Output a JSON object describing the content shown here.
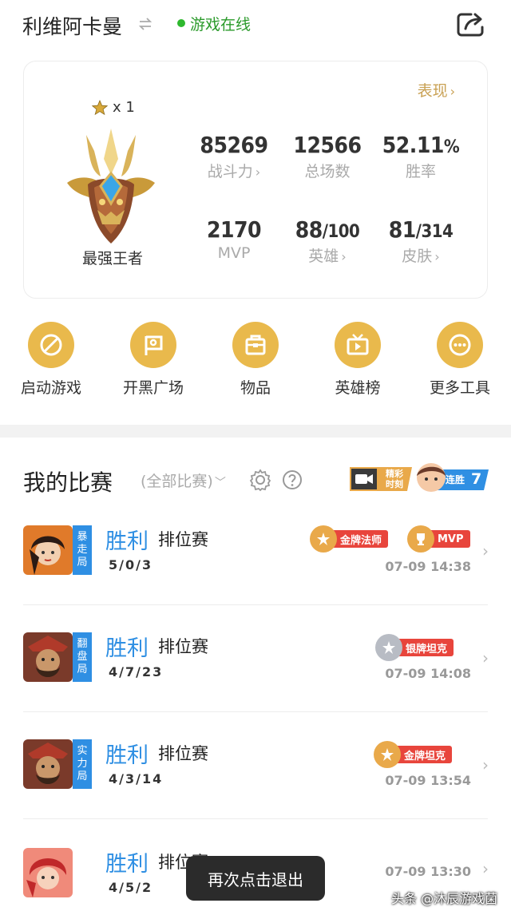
{
  "header": {
    "player_name": "利维阿卡曼",
    "status": "游戏在线"
  },
  "profile": {
    "performance_link": "表现",
    "stars": "x 1",
    "rank": "最强王者",
    "stats": [
      {
        "value": "85269",
        "label": "战斗力",
        "has_chevron": true
      },
      {
        "value": "12566",
        "label": "总场数",
        "has_chevron": false
      },
      {
        "value": "52.11",
        "suffix": "%",
        "label": "胜率",
        "has_chevron": false
      },
      {
        "value": "2170",
        "label": "MVP",
        "has_chevron": false
      },
      {
        "value": "88",
        "suffix": "/100",
        "label": "英雄",
        "has_chevron": true
      },
      {
        "value": "81",
        "suffix": "/314",
        "label": "皮肤",
        "has_chevron": true
      }
    ]
  },
  "tools": [
    {
      "label": "启动游戏",
      "icon": "launch-game-icon"
    },
    {
      "label": "开黑广场",
      "icon": "team-square-icon"
    },
    {
      "label": "物品",
      "icon": "items-bag-icon"
    },
    {
      "label": "英雄榜",
      "icon": "hero-ranking-icon"
    },
    {
      "label": "更多工具",
      "icon": "more-icon"
    }
  ],
  "matches_section": {
    "title": "我的比赛",
    "filter": "(全部比赛)",
    "highlight_badge": {
      "line1": "精彩",
      "line2": "时刻"
    },
    "streak_badge": {
      "label": "连胜",
      "count": "7"
    }
  },
  "matches": [
    {
      "mode_tag": [
        "暴",
        "走",
        "局"
      ],
      "result": "胜利",
      "mode": "排位赛",
      "kda": "5/0/3",
      "time": "07-09 14:38",
      "medals": [
        {
          "text": "金牌法师",
          "type": "gold"
        },
        {
          "text": "MVP",
          "type": "mvp"
        }
      ]
    },
    {
      "mode_tag": [
        "翻",
        "盘",
        "局"
      ],
      "result": "胜利",
      "mode": "排位赛",
      "kda": "4/7/23",
      "time": "07-09 14:08",
      "medals": [
        {
          "text": "银牌坦克",
          "type": "silver"
        }
      ]
    },
    {
      "mode_tag": [
        "实",
        "力",
        "局"
      ],
      "result": "胜利",
      "mode": "排位赛",
      "kda": "4/3/14",
      "time": "07-09 13:54",
      "medals": [
        {
          "text": "金牌坦克",
          "type": "gold"
        }
      ]
    },
    {
      "mode_tag": [],
      "result": "胜利",
      "mode": "排位赛",
      "kda": "4/5/2",
      "time": "07-09 13:30",
      "medals": []
    }
  ],
  "toast": "再次点击退出",
  "watermark": "头条 @沐辰游戏菌",
  "colors": {
    "accent_gold": "#e9b94c",
    "win_blue": "#2f8fe3",
    "online_green": "#2eb82e",
    "medal_red": "#e8453c"
  }
}
